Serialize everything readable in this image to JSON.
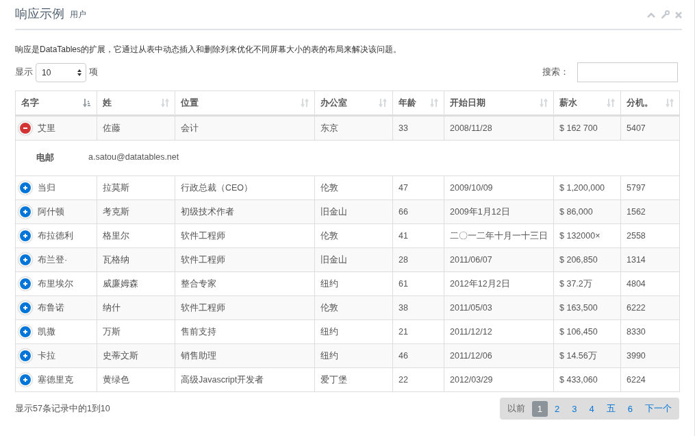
{
  "panel": {
    "title": "响应示例",
    "subtitle": "用户"
  },
  "description": "响应是DataTables的扩展，它通过从表中动态插入和删除列来优化不同屏幕大小的表的布局来解决该问题。",
  "length_control": {
    "prefix": "显示",
    "value": "10",
    "suffix": "项"
  },
  "search": {
    "label": "搜索："
  },
  "table": {
    "columns": [
      {
        "label": "名字",
        "sorted": true
      },
      {
        "label": "姓",
        "sorted": false
      },
      {
        "label": "位置",
        "sorted": false
      },
      {
        "label": "办公室",
        "sorted": false
      },
      {
        "label": "年龄",
        "sorted": false
      },
      {
        "label": "开始日期",
        "sorted": false
      },
      {
        "label": "薪水",
        "sorted": false
      },
      {
        "label": "分机。",
        "sorted": false
      }
    ],
    "rows": [
      {
        "expanded": true,
        "cells": [
          "艾里",
          "佐藤",
          "会计",
          "东京",
          "33",
          "2008/11/28",
          "$ 162 700",
          "5407"
        ],
        "details": [
          {
            "label": "电邮",
            "value": "a.satou@datatables.net"
          }
        ]
      },
      {
        "expanded": false,
        "cells": [
          "当归",
          "拉莫斯",
          "行政总裁（CEO）",
          "伦敦",
          "47",
          "2009/10/09",
          "$ 1,200,000",
          "5797"
        ]
      },
      {
        "expanded": false,
        "cells": [
          "阿什顿",
          "考克斯",
          "初级技术作者",
          "旧金山",
          "66",
          "2009年1月12日",
          "$ 86,000",
          "1562"
        ]
      },
      {
        "expanded": false,
        "cells": [
          "布拉德利",
          "格里尔",
          "软件工程师",
          "伦敦",
          "41",
          "二〇一二年十月一十三日",
          "$ 132000×",
          "2558"
        ]
      },
      {
        "expanded": false,
        "cells": [
          "布兰登·",
          "瓦格纳",
          "软件工程师",
          "旧金山",
          "28",
          "2011/06/07",
          "$ 206,850",
          "1314"
        ]
      },
      {
        "expanded": false,
        "cells": [
          "布里埃尔",
          "威廉姆森",
          "整合专家",
          "纽约",
          "61",
          "2012年12月2日",
          "$ 37.2万",
          "4804"
        ]
      },
      {
        "expanded": false,
        "cells": [
          "布鲁诺",
          "纳什",
          "软件工程师",
          "伦敦",
          "38",
          "2011/05/03",
          "$ 163,500",
          "6222"
        ]
      },
      {
        "expanded": false,
        "cells": [
          "凯撒",
          "万斯",
          "售前支持",
          "纽约",
          "21",
          "2011/12/12",
          "$ 106,450",
          "8330"
        ]
      },
      {
        "expanded": false,
        "cells": [
          "卡拉",
          "史蒂文斯",
          "销售助理",
          "纽约",
          "46",
          "2011/12/06",
          "$ 14.56万",
          "3990"
        ]
      },
      {
        "expanded": false,
        "cells": [
          "塞德里克",
          "黄绿色",
          "高级Javascript开发者",
          "爱丁堡",
          "22",
          "2012/03/29",
          "$ 433,060",
          "6224"
        ]
      }
    ]
  },
  "info": "显示57条记录中的1到10",
  "pagination": {
    "previous": "以前",
    "next": "下一个",
    "pages": [
      {
        "label": "1",
        "selected": true
      },
      {
        "label": "2",
        "selected": false
      },
      {
        "label": "3",
        "selected": false
      },
      {
        "label": "4",
        "selected": false
      },
      {
        "label": "五",
        "selected": false
      },
      {
        "label": "6",
        "selected": false
      }
    ]
  }
}
